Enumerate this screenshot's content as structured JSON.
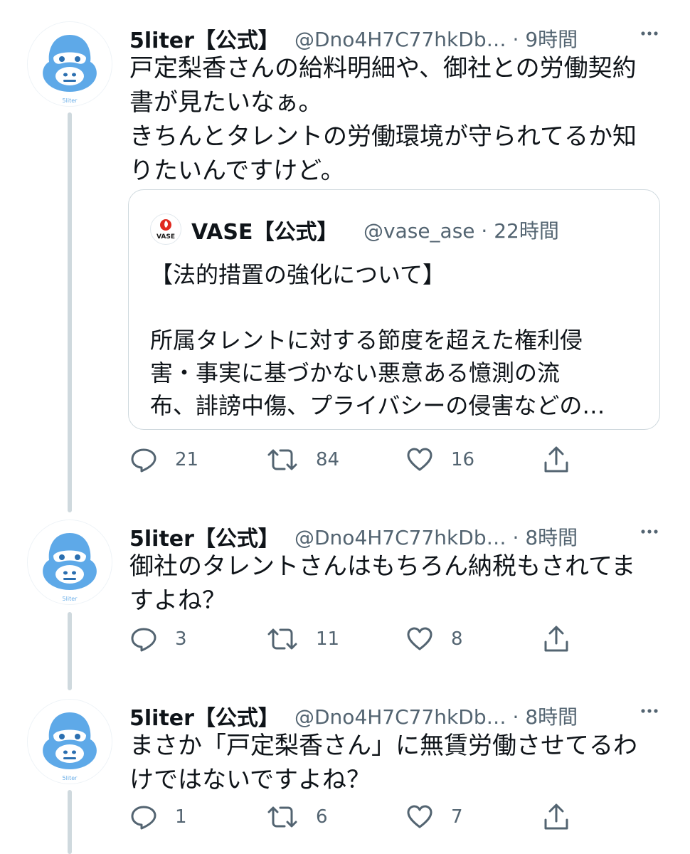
{
  "colors": {
    "accent_avatar": "#5ea9e8",
    "text": "#0f1419",
    "muted": "#536471",
    "border": "#cfd9de"
  },
  "tweets": [
    {
      "author_name": "5liter【公式】",
      "handle": "@Dno4H7C77hkDb…",
      "time": "· 9時間",
      "more_icon": "more-dots-icon",
      "avatar_caption": "5liter",
      "text": "戸定梨香さんの給料明細や、御社との労働契約\n書が見たいなぁ。\nきちんとタレントの労働環境が守られてるか知\nりたいんですけど。",
      "quote": {
        "author_name": "VASE【公式】",
        "handle": "@vase_ase · 22時間",
        "logo_text": "VASE",
        "text": "【法的措置の強化について】\n\n所属タレントに対する節度を超えた権利侵\n害・事実に基づかない悪意ある憶測の流\n布、誹謗中傷、プライバシーの侵害などの…"
      },
      "replies": "21",
      "retweets": "84",
      "likes": "16"
    },
    {
      "author_name": "5liter【公式】",
      "handle": "@Dno4H7C77hkDb…",
      "time": "· 8時間",
      "avatar_caption": "5liter",
      "text": "御社のタレントさんはもちろん納税もされてま\nすよね？",
      "replies": "3",
      "retweets": "11",
      "likes": "8"
    },
    {
      "author_name": "5liter【公式】",
      "handle": "@Dno4H7C77hkDb…",
      "time": "· 8時間",
      "avatar_caption": "5liter",
      "text": "まさか「戸定梨香さん」に無賃労働させてるわ\nけではないですよね？",
      "replies": "1",
      "retweets": "6",
      "likes": "7"
    }
  ]
}
